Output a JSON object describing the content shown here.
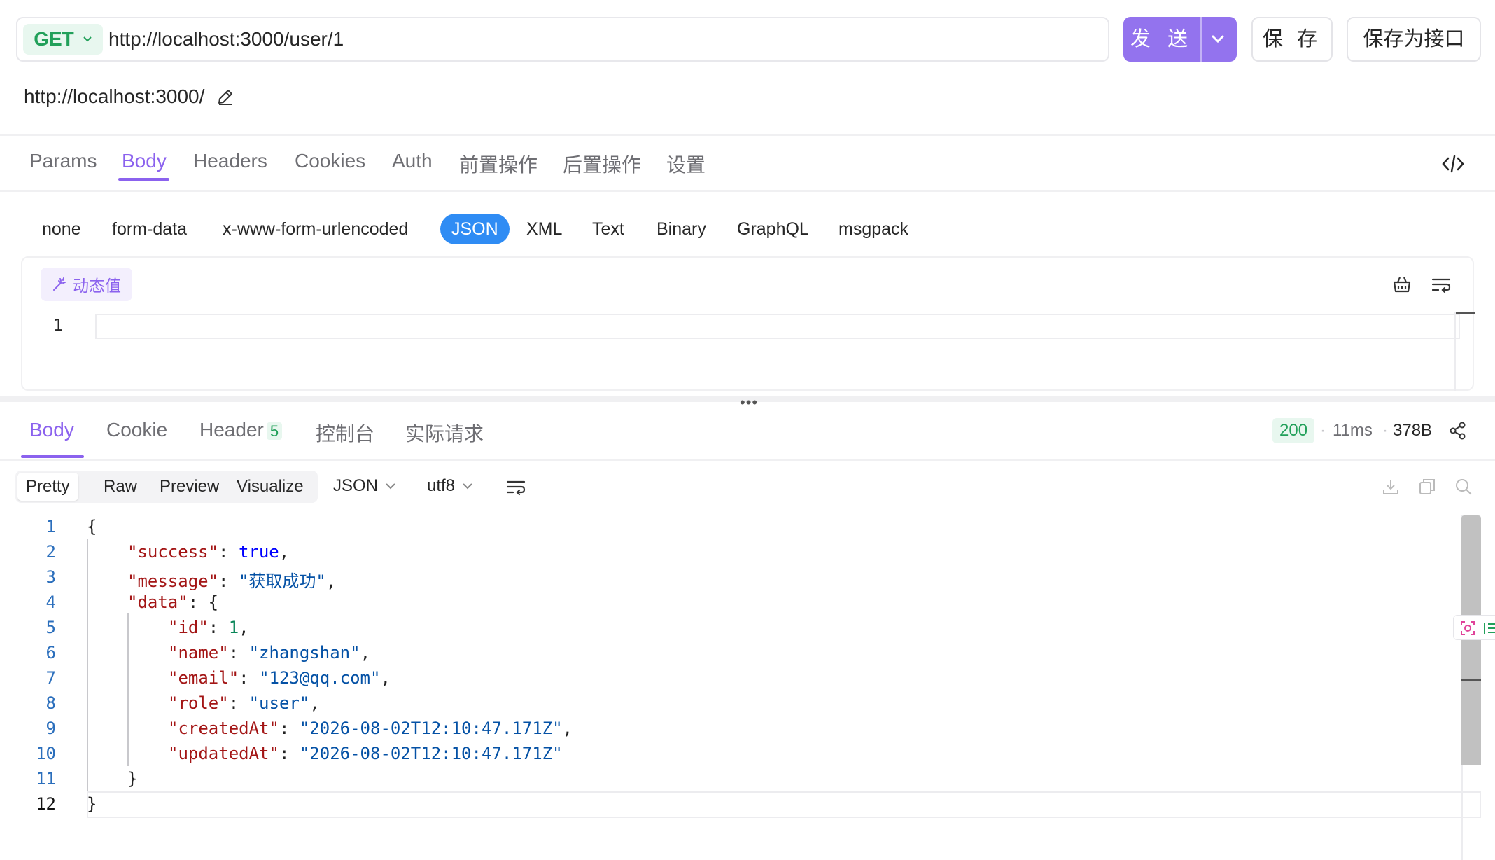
{
  "request": {
    "method": "GET",
    "url": "http://localhost:3000/user/1",
    "base_url": "http://localhost:3000/",
    "send_label": "发 送",
    "save_label": "保 存",
    "save_as_api_label": "保存为接口"
  },
  "request_tabs": [
    {
      "label": "Params",
      "active": false
    },
    {
      "label": "Body",
      "active": true
    },
    {
      "label": "Headers",
      "active": false
    },
    {
      "label": "Cookies",
      "active": false
    },
    {
      "label": "Auth",
      "active": false
    },
    {
      "label": "前置操作",
      "active": false
    },
    {
      "label": "后置操作",
      "active": false
    },
    {
      "label": "设置",
      "active": false
    }
  ],
  "body_types": [
    {
      "label": "none",
      "active": false
    },
    {
      "label": "form-data",
      "active": false
    },
    {
      "label": "x-www-form-urlencoded",
      "active": false
    },
    {
      "label": "JSON",
      "active": true
    },
    {
      "label": "XML",
      "active": false
    },
    {
      "label": "Text",
      "active": false
    },
    {
      "label": "Binary",
      "active": false
    },
    {
      "label": "GraphQL",
      "active": false
    },
    {
      "label": "msgpack",
      "active": false
    }
  ],
  "editor": {
    "dynamic_value_label": "动态值",
    "line_numbers": [
      "1"
    ]
  },
  "response_tabs": [
    {
      "label": "Body",
      "active": true
    },
    {
      "label": "Cookie",
      "active": false
    },
    {
      "label": "Header",
      "active": false,
      "count": "5"
    },
    {
      "label": "控制台",
      "active": false
    },
    {
      "label": "实际请求",
      "active": false
    }
  ],
  "response_meta": {
    "status": "200",
    "time": "11ms",
    "size": "378B",
    "separator": "·"
  },
  "view_modes": [
    {
      "label": "Pretty",
      "active": true
    },
    {
      "label": "Raw",
      "active": false
    },
    {
      "label": "Preview",
      "active": false
    },
    {
      "label": "Visualize",
      "active": false
    }
  ],
  "format_select": "JSON",
  "encoding_select": "utf8",
  "response_body": {
    "line_numbers": [
      "1",
      "2",
      "3",
      "4",
      "5",
      "6",
      "7",
      "8",
      "9",
      "10",
      "11",
      "12"
    ],
    "open_brace": "{",
    "close_brace": "}",
    "success_key": "\"success\"",
    "success_value": "true",
    "message_key": "\"message\"",
    "message_value": "\"获取成功\"",
    "data_key": "\"data\"",
    "id_key": "\"id\"",
    "id_value": "1",
    "name_key": "\"name\"",
    "name_value": "\"zhangshan\"",
    "email_key": "\"email\"",
    "email_value": "\"123@qq.com\"",
    "role_key": "\"role\"",
    "role_value": "\"user\"",
    "created_key": "\"createdAt\"",
    "created_value": "\"2026-08-02T12:10:47.171Z\"",
    "updated_key": "\"updatedAt\"",
    "updated_value": "\"2026-08-02T12:10:47.171Z\""
  },
  "colors": {
    "accent": "#8b62ee",
    "send_button": "#9373ee",
    "method_get": "#22a05a",
    "json_chip": "#2f8cf4",
    "status_ok": "#22a05a"
  }
}
